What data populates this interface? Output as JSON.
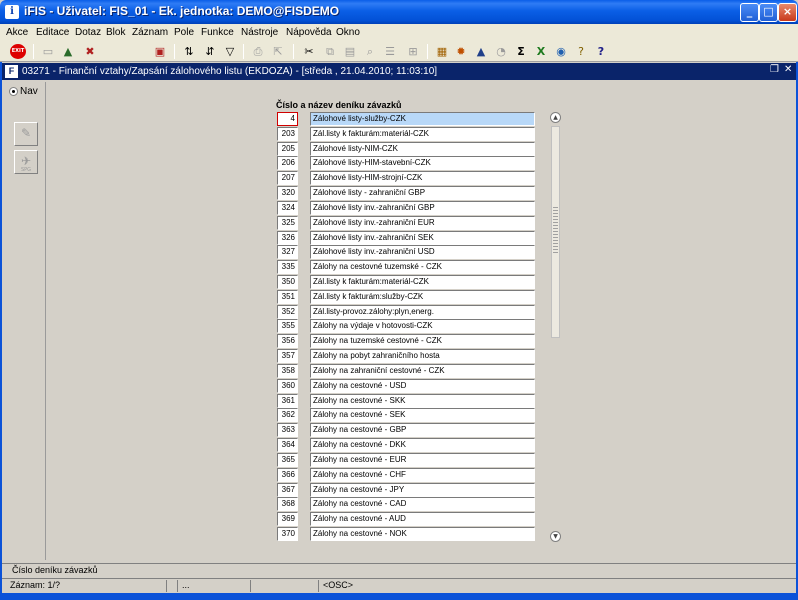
{
  "window": {
    "app_title": "iFIS - Uživatel: FIS_01 - Ek. jednotka: DEMO@FISDEMO",
    "minimize": "_",
    "maximize": "□",
    "close": "×"
  },
  "menu": [
    "Akce",
    "Editace",
    "Dotaz",
    "Blok",
    "Záznam",
    "Pole",
    "Funkce",
    "Nástroje",
    "Nápověda",
    "Okno"
  ],
  "toolbar": {
    "icons": [
      "exit-icon",
      "print-preview-icon",
      "save-icon",
      "delete-icon",
      "clear-icon",
      "sort-asc-icon",
      "sort-desc-icon",
      "filter-icon",
      "print-icon",
      "export-icon",
      "cut-icon",
      "copy-icon",
      "paste-icon",
      "find-icon",
      "list-icon",
      "tree-icon",
      "calculator-icon",
      "settings-icon",
      "triangle-icon",
      "chart-icon",
      "sum-icon",
      "excel-icon",
      "web-icon",
      "window-icon",
      "help-icon"
    ]
  },
  "form": {
    "title": "03271 - Finanční vztahy/Zapsání zálohového listu (EKDOZA) - [středa , 21.04.2010; 11:03:10]",
    "heading": "Číslo a název deníku závazků",
    "nav_label": "Nav",
    "side_button_caption": "SPG"
  },
  "rows": [
    {
      "num": "4",
      "name": "Zálohové listy-služby-CZK"
    },
    {
      "num": "203",
      "name": "Zál.listy k fakturám:materiál-CZK"
    },
    {
      "num": "205",
      "name": "Zálohové listy-NIM-CZK"
    },
    {
      "num": "206",
      "name": "Zálohové listy-HIM-stavební-CZK"
    },
    {
      "num": "207",
      "name": "Zálohové listy-HIM-strojní-CZK"
    },
    {
      "num": "320",
      "name": "Zálohové listy - zahraniční GBP"
    },
    {
      "num": "324",
      "name": "Zálohové listy inv.-zahraniční GBP"
    },
    {
      "num": "325",
      "name": "Zálohové listy inv.-zahraniční EUR"
    },
    {
      "num": "326",
      "name": "Zálohové listy inv.-zahraniční SEK"
    },
    {
      "num": "327",
      "name": "Zálohové listy inv.-zahraniční USD"
    },
    {
      "num": "335",
      "name": "Zálohy na cestovné tuzemské - CZK"
    },
    {
      "num": "350",
      "name": "Zál.listy k fakturám:materiál-CZK"
    },
    {
      "num": "351",
      "name": "Zál.listy k fakturám:služby-CZK"
    },
    {
      "num": "352",
      "name": "Zál.listy-provoz.zálohy:plyn,energ."
    },
    {
      "num": "355",
      "name": "Zálohy na výdaje v hotovosti-CZK"
    },
    {
      "num": "356",
      "name": "Zálohy na tuzemské cestovné - CZK"
    },
    {
      "num": "357",
      "name": "Zálohy na pobyt zahraničního hosta"
    },
    {
      "num": "358",
      "name": "Zálohy na zahraniční cestovné - CZK"
    },
    {
      "num": "360",
      "name": "Zálohy na cestovné - USD"
    },
    {
      "num": "361",
      "name": "Zálohy na cestovné - SKK"
    },
    {
      "num": "362",
      "name": "Zálohy na cestovné - SEK"
    },
    {
      "num": "363",
      "name": "Zálohy na cestovné - GBP"
    },
    {
      "num": "364",
      "name": "Zálohy na cestovné - DKK"
    },
    {
      "num": "365",
      "name": "Zálohy na cestovné - EUR"
    },
    {
      "num": "366",
      "name": "Zálohy na cestovné - CHF"
    },
    {
      "num": "367",
      "name": "Zálohy na cestovné - JPY"
    },
    {
      "num": "368",
      "name": "Zálohy na cestovné - CAD"
    },
    {
      "num": "369",
      "name": "Zálohy na cestovné - AUD"
    },
    {
      "num": "370",
      "name": "Zálohy na cestovné - NOK"
    }
  ],
  "status": {
    "hint": "Číslo deníku závazků",
    "record": "Záznam: 1/?",
    "dots": "...",
    "mode": "<OSC>"
  },
  "colors": {
    "titlebar": "#0b5fe6",
    "selected_row": "#b8d8f8",
    "selected_border": "#d00000"
  }
}
